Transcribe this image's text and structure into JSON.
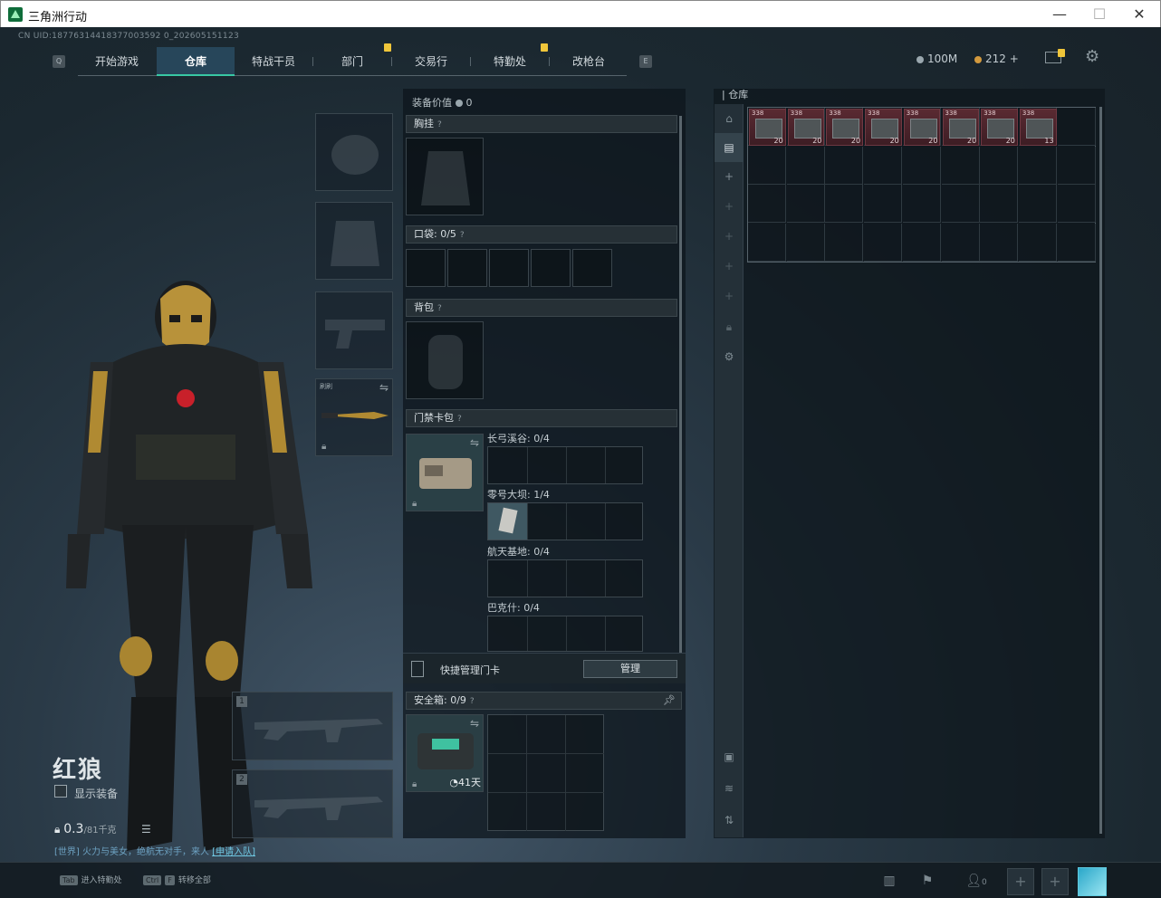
{
  "window": {
    "title": "三角洲行动",
    "min": "—",
    "max": "☐",
    "close": "✕"
  },
  "uid": "CN UID:18776314418377003592 0_202605151123",
  "nav": {
    "left_key": "Q",
    "right_key": "E",
    "tabs": [
      {
        "label": "开始游戏"
      },
      {
        "label": "仓库"
      },
      {
        "label": "特战干员"
      },
      {
        "label": "部门"
      },
      {
        "label": "交易行"
      },
      {
        "label": "特勤处"
      },
      {
        "label": "改枪台"
      }
    ]
  },
  "currency": {
    "silver": "100M",
    "gold": "212",
    "gold_add": "+"
  },
  "character": {
    "name": "红狼",
    "show_equip": "显示装备",
    "weight": "0.3",
    "weight_max": "/81千克",
    "motto_prefix": "[世界] 火力与",
    "motto_mid": "美女",
    "motto_text": "，绝航无对手，来人",
    "motto_link": "[申请入队]"
  },
  "equip": {
    "value_label": "装备价值",
    "value": "0",
    "sections": {
      "vest": "胸挂",
      "pocket": "口袋:",
      "pocket_count": "0/5",
      "backpack": "背包",
      "keycard": "门禁卡包",
      "secure": "安全箱:",
      "secure_count": "0/9"
    },
    "maps": [
      {
        "name": "长弓溪谷: 0/4"
      },
      {
        "name": "零号大坝: 1/4"
      },
      {
        "name": "航天基地: 0/4"
      },
      {
        "name": "巴克什: 0/4"
      }
    ],
    "quick_label": "快捷管理门卡",
    "manage_btn": "管理",
    "secure_days": "41天",
    "weapon_tag": "刷刷",
    "slot1": "1",
    "slot2": "2"
  },
  "warehouse": {
    "title": "仓库",
    "items": [
      {
        "tl": "338",
        "br": "20"
      },
      {
        "tl": "338",
        "br": "20"
      },
      {
        "tl": "338",
        "br": "20"
      },
      {
        "tl": "338",
        "br": "20"
      },
      {
        "tl": "338",
        "br": "20"
      },
      {
        "tl": "338",
        "br": "20"
      },
      {
        "tl": "338",
        "br": "20"
      },
      {
        "tl": "338",
        "br": "13"
      }
    ]
  },
  "bottom": {
    "tab_key": "Tab",
    "tab_hint": "进入特勤处",
    "ctrl_key": "Ctrl",
    "f_key": "F",
    "ctrl_hint": "转移全部",
    "friends_count": "0"
  },
  "colors": {
    "accent": "#38c8a4",
    "item_red": "#5a2a32",
    "badge": "#f0c63a"
  }
}
